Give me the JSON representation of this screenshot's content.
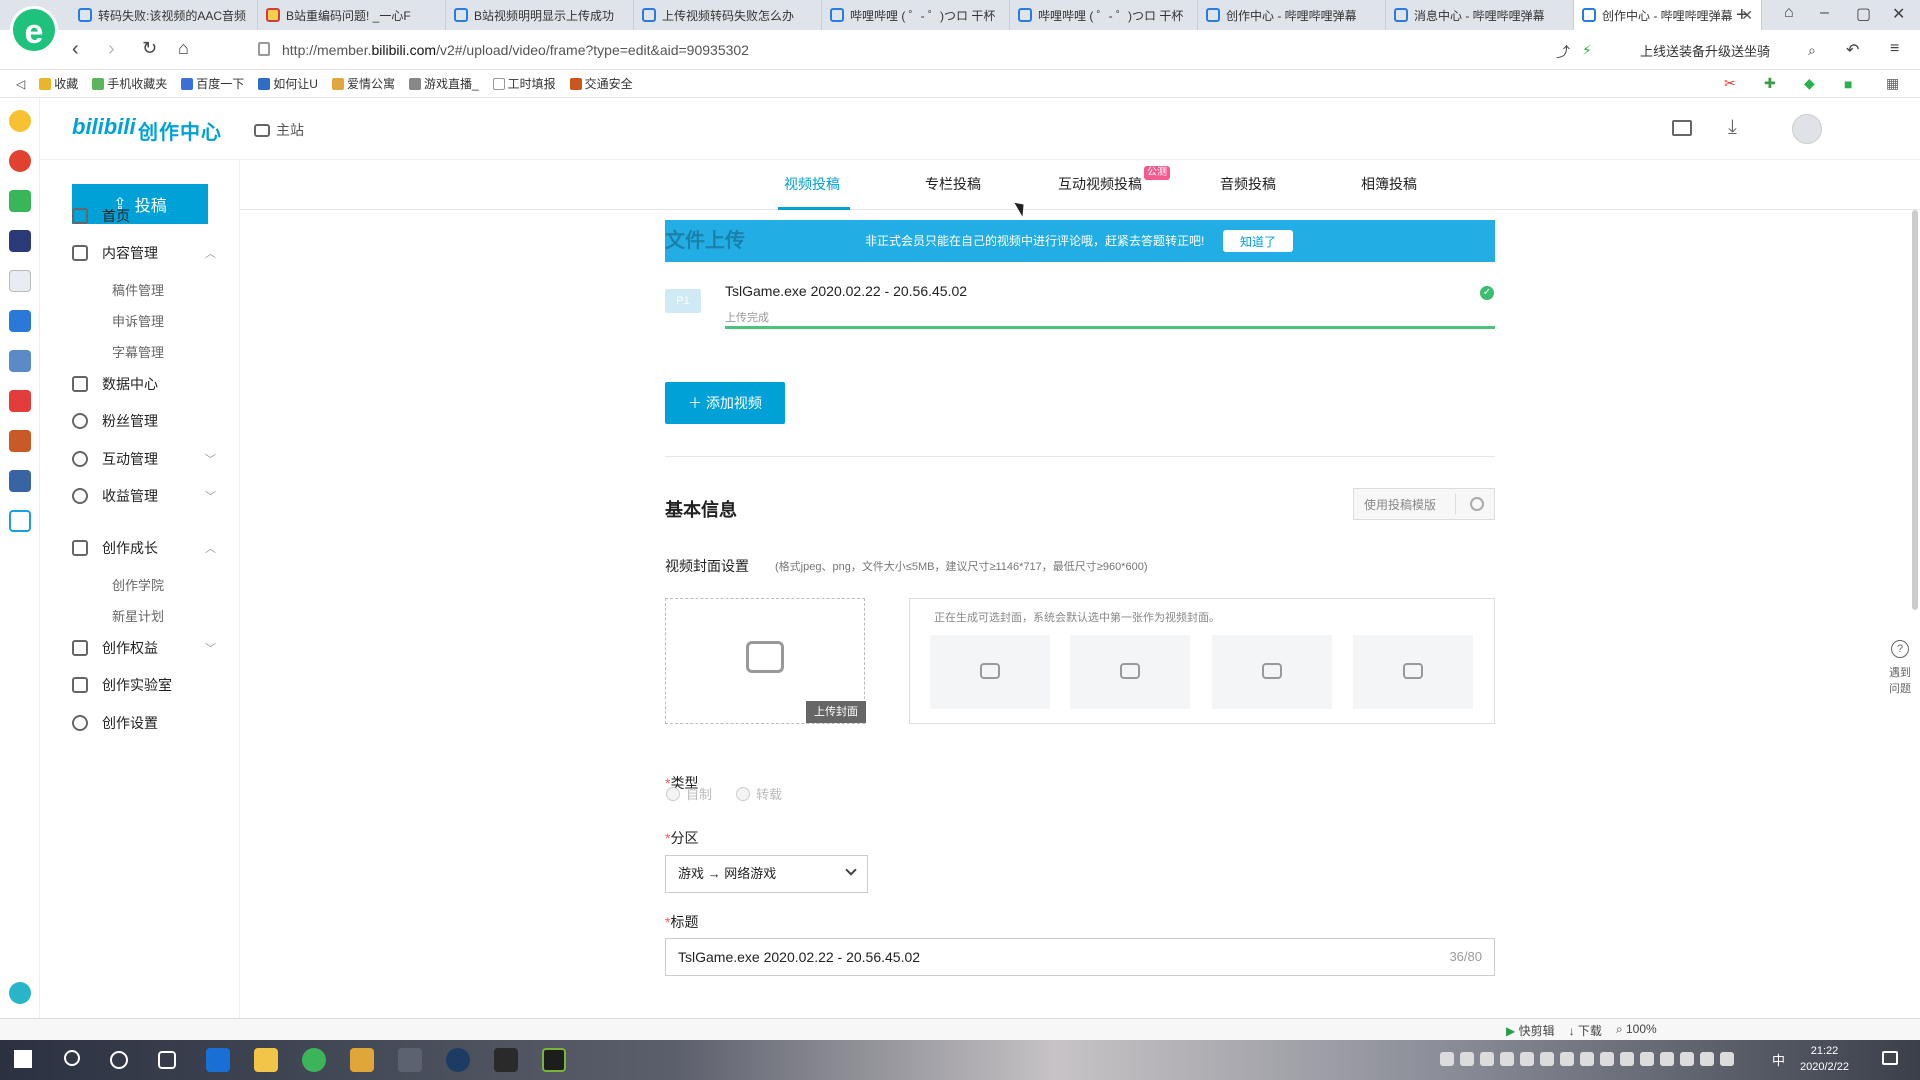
{
  "browser": {
    "tabs": [
      {
        "title": "转码失败:该视频的AAC音频"
      },
      {
        "title": "B站重编码问题! _一心F"
      },
      {
        "title": "B站视频明明显示上传成功"
      },
      {
        "title": "上传视频转码失败怎么办"
      },
      {
        "title": "哔哩哔哩 ( ゜- ゜)つロ 干杯"
      },
      {
        "title": "哔哩哔哩 ( ゜- ゜)つロ 干杯"
      },
      {
        "title": "创作中心 - 哔哩哔哩弹幕"
      },
      {
        "title": "消息中心 - 哔哩哔哩弹幕"
      },
      {
        "title": "创作中心 - 哔哩哔哩弹幕"
      }
    ],
    "url_prefix": "http://member.",
    "url_domain": "bilibili.com",
    "url_path": "/v2#/upload/video/frame?type=edit&aid=90935302",
    "addr_right": "上线送装备升级送坐骑",
    "bookmarks": [
      "收藏",
      "手机收藏夹",
      "百度一下",
      "如何让U",
      "爱情公寓",
      "游戏直播_",
      "工时填报",
      "交通安全"
    ],
    "status_items": [
      "快剪辑",
      "下载",
      "100%"
    ]
  },
  "header": {
    "logo": "bilibili",
    "logo_sub": "创作中心",
    "main_site": "主站"
  },
  "sidebar": {
    "upload_label": "投稿",
    "items": [
      {
        "label": "首页"
      },
      {
        "label": "内容管理"
      },
      {
        "label": "稿件管理"
      },
      {
        "label": "申诉管理"
      },
      {
        "label": "字幕管理"
      },
      {
        "label": "数据中心"
      },
      {
        "label": "粉丝管理"
      },
      {
        "label": "互动管理"
      },
      {
        "label": "收益管理"
      },
      {
        "label": "创作成长"
      },
      {
        "label": "创作学院"
      },
      {
        "label": "新星计划"
      },
      {
        "label": "创作权益"
      },
      {
        "label": "创作实验室"
      },
      {
        "label": "创作设置"
      }
    ]
  },
  "toptabs": [
    {
      "label": "视频投稿"
    },
    {
      "label": "专栏投稿"
    },
    {
      "label": "互动视频投稿"
    },
    {
      "label": "音频投稿"
    },
    {
      "label": "相簿投稿"
    }
  ],
  "beta_badge": "公测",
  "notice": {
    "bg_title": "文件上传",
    "text": "非正式会员只能在自己的视频中进行评论哦，赶紧去答题转正吧!",
    "button": "知道了"
  },
  "upload": {
    "part": "P1",
    "filename": "TslGame.exe 2020.02.22 - 20.56.45.02",
    "status": "上传完成",
    "progress": 1.0,
    "add_video": "添加视频"
  },
  "basic_info": {
    "title": "基本信息",
    "template_button": "使用投稿模版"
  },
  "cover": {
    "label": "视频封面设置",
    "hint": "(格式jpeg、png，文件大小≤5MB，建议尺寸≥1146*717，最低尺寸≥960*600)",
    "upload_button": "上传封面",
    "candidates_hint": "正在生成可选封面，系统会默认选中第一张作为视频封面。"
  },
  "type_field": {
    "label": "类型",
    "options": [
      "自制",
      "转载"
    ]
  },
  "region_field": {
    "label": "分区",
    "value": "游戏 → 网络游戏"
  },
  "title_field": {
    "label": "标题",
    "value": "TslGame.exe 2020.02.22 - 20.56.45.02",
    "count": "36/80"
  },
  "help": {
    "line1": "遇到",
    "line2": "问题"
  },
  "taskbar": {
    "ime": "中",
    "time": "21:22",
    "date": "2020/2/22"
  }
}
